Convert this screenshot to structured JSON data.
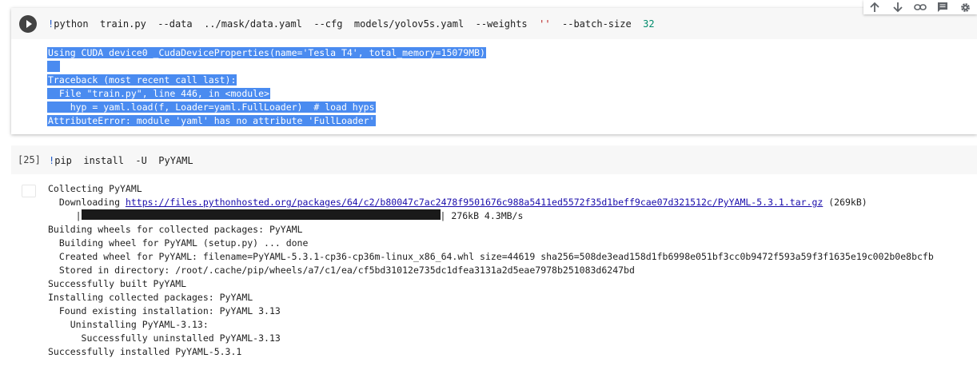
{
  "toolbar": {
    "icons": [
      "arrow-up-icon",
      "arrow-down-icon",
      "link-icon",
      "comment-icon",
      "gear-icon"
    ]
  },
  "cell1": {
    "code": {
      "bang": "!",
      "cmd": "python  train.py  --data  ../mask/data.yaml  --cfg  models/yolov5s.yaml  --weights  ",
      "str": "''",
      "rest": "  --batch-size  ",
      "num": "32"
    },
    "output": [
      "Using CUDA device0 _CudaDeviceProperties(name='Tesla T4', total_memory=15079MB)",
      "",
      "Traceback (most recent call last):",
      "  File \"train.py\", line 446, in <module>",
      "    hyp = yaml.load(f, Loader=yaml.FullLoader)  # load hyps",
      "AttributeError: module 'yaml' has no attribute 'FullLoader'"
    ]
  },
  "cell2": {
    "exec_count": "[25]",
    "code": {
      "bang": "!",
      "cmd": "pip  install  -U  PyYAML"
    },
    "output": {
      "collecting": "Collecting PyYAML",
      "downloading_prefix": "  Downloading ",
      "download_url": "https://files.pythonhosted.org/packages/64/c2/b80047c7ac2478f9501676c988a5411ed5572f35d1beff9cae07d321512c/PyYAML-5.3.1.tar.gz",
      "download_size": " (269kB)",
      "progress_prefix": "     |",
      "progress_suffix": "| 276kB 4.3MB/s",
      "progress_fraction": 1.0,
      "lines": [
        "Building wheels for collected packages: PyYAML",
        "  Building wheel for PyYAML (setup.py) ... done",
        "  Created wheel for PyYAML: filename=PyYAML-5.3.1-cp36-cp36m-linux_x86_64.whl size=44619 sha256=508de3ead158d1fb6998e051bf3cc0b9472f593a59f3f1635e19c002b0e8bcfb",
        "  Stored in directory: /root/.cache/pip/wheels/a7/c1/ea/cf5bd31012e735dc1dfea3131a2d5eae7978b251083d6247bd",
        "Successfully built PyYAML",
        "Installing collected packages: PyYAML",
        "  Found existing installation: PyYAML 3.13",
        "    Uninstalling PyYAML-3.13:",
        "      Successfully uninstalled PyYAML-3.13",
        "Successfully installed PyYAML-5.3.1"
      ]
    }
  }
}
